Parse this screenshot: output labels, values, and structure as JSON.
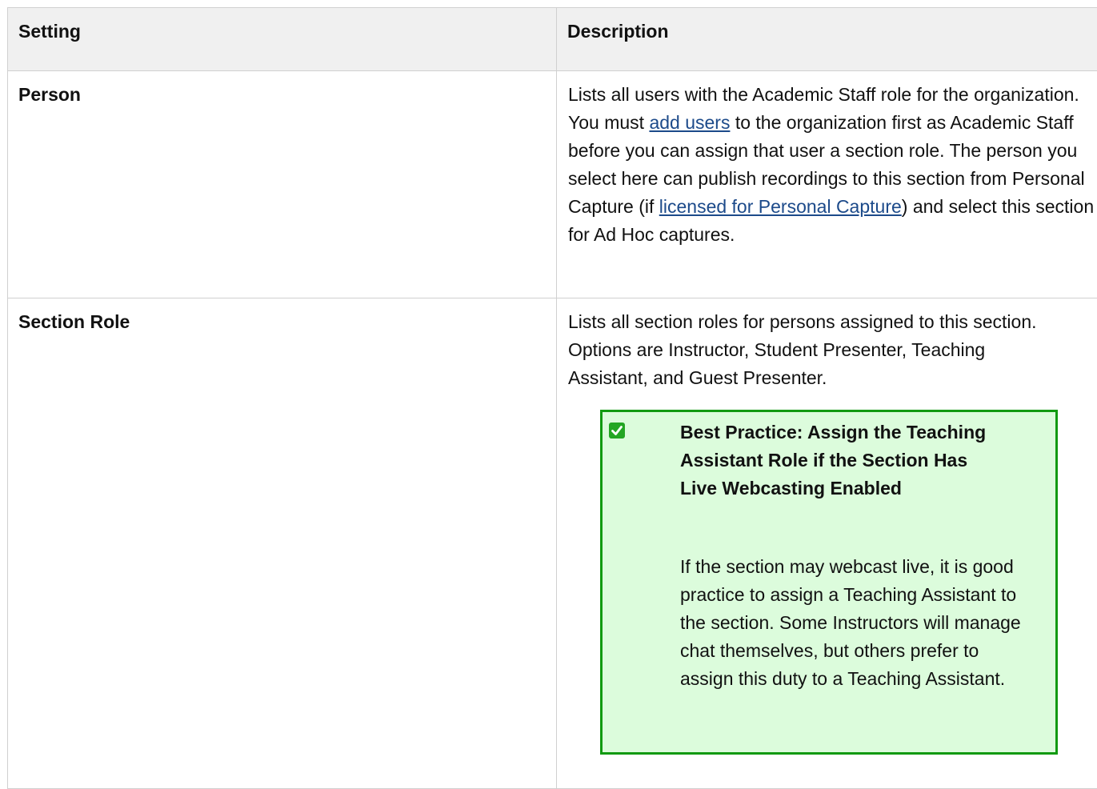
{
  "table": {
    "headers": {
      "setting": "Setting",
      "description": "Description"
    },
    "rows": [
      {
        "setting": "Person",
        "description": {
          "part1": "Lists all users with the Academic Staff role for the organization. You must ",
          "link1": "add users",
          "part2": " to the organization first as Academic Staff before you can assign that user a section role. The person you select here can publish recordings to this section from Personal Capture (if  ",
          "link2": "licensed for Personal Capture",
          "part3": ") and select this section for Ad Hoc captures."
        }
      },
      {
        "setting": "Section Role",
        "description": "Lists all section roles for persons assigned to this section. Options are Instructor, Student Presenter, Teaching Assistant, and Guest Presenter.",
        "best_practice": {
          "icon": "check-icon",
          "title": "Best Practice: Assign the Teaching Assistant Role if the Section Has Live Webcasting Enabled",
          "body": "If the section may webcast live, it is good practice to assign a Teaching Assistant to the section. Some Instructors will manage chat themselves, but others prefer to assign this duty to a Teaching Assistant."
        }
      }
    ]
  },
  "colors": {
    "link": "#1c4a8a",
    "header_bg": "#f0f0f0",
    "callout_bg": "#dcfcdc",
    "callout_border": "#119a11",
    "check_icon": "#23a623"
  }
}
